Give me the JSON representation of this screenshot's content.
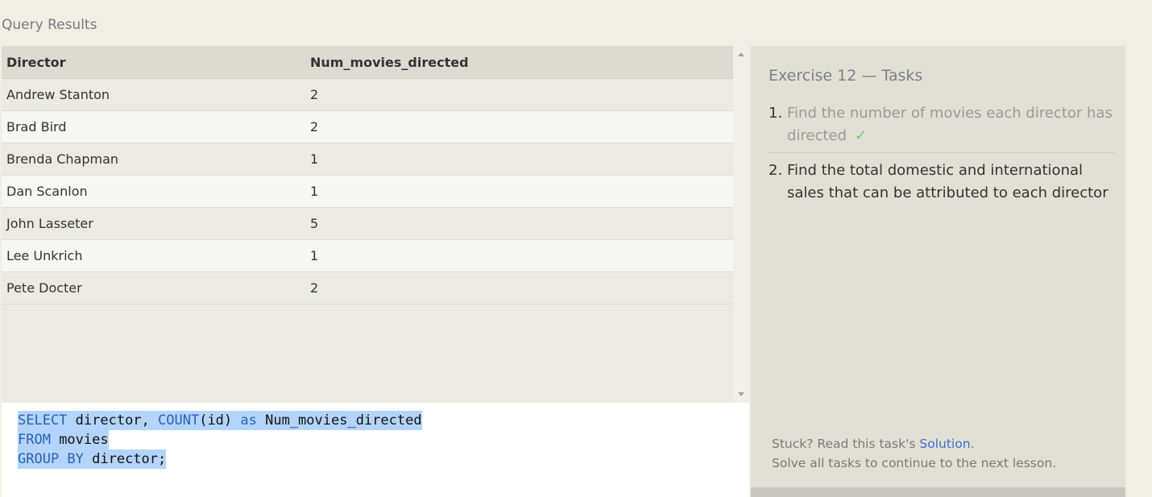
{
  "results": {
    "heading": "Query Results",
    "columns": [
      "Director",
      "Num_movies_directed"
    ],
    "rows": [
      [
        "Andrew Stanton",
        "2"
      ],
      [
        "Brad Bird",
        "2"
      ],
      [
        "Brenda Chapman",
        "1"
      ],
      [
        "Dan Scanlon",
        "1"
      ],
      [
        "John Lasseter",
        "5"
      ],
      [
        "Lee Unkrich",
        "1"
      ],
      [
        "Pete Docter",
        "2"
      ]
    ]
  },
  "editor": {
    "lines": [
      {
        "kw1": "SELECT",
        "t1": " director, ",
        "kw2": "COUNT",
        "t2": "(id) ",
        "kw3": "as",
        "t3": " Num_movies_directed"
      },
      {
        "kw1": "FROM",
        "t1": " movies"
      },
      {
        "kw1": "GROUP BY",
        "t1": " director;"
      }
    ]
  },
  "tasks": {
    "title": "Exercise 12 — Tasks",
    "items": [
      {
        "num": "1.",
        "text": "Find the number of movies each director has directed",
        "done": true,
        "check": "✓"
      },
      {
        "num": "2.",
        "text": "Find the total domestic and international sales that can be attributed to each director",
        "done": false
      }
    ],
    "stuck_prefix": "Stuck? Read this task's ",
    "solution_label": "Solution",
    "stuck_suffix": ".",
    "continue_text": "Solve all tasks to continue to the next lesson."
  },
  "colors": {
    "keyword": "#2b62b4",
    "selection": "#b3d4fc",
    "check": "#6bc96b",
    "link": "#3b6fd0"
  }
}
